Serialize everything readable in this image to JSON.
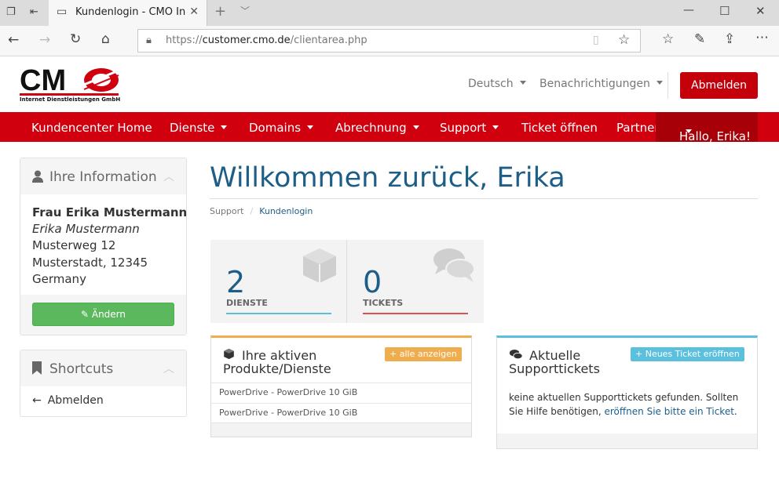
{
  "browser": {
    "tab_title": "Kundenlogin - CMO Internet Dienstleistungen GmbH",
    "url_prefix": "https://",
    "url_host": "customer.cmo.de",
    "url_path": "/clientarea.php"
  },
  "logo": {
    "brand": "CMO",
    "tagline": "Internet Dienstleistungen GmbH"
  },
  "header": {
    "language": "Deutsch",
    "notifications": "Benachrichtigungen",
    "logout": "Abmelden"
  },
  "nav": {
    "items": [
      "Kundencenter Home",
      "Dienste",
      "Domains",
      "Abrechnung",
      "Support",
      "Ticket öffnen",
      "Partner"
    ],
    "user": "Hallo, Erika!"
  },
  "sidebar": {
    "info_title": "Ihre Information",
    "name": "Frau Erika Mustermann",
    "company": "Erika Mustermann",
    "street": "Musterweg 12",
    "city": "Musterstadt, 12345",
    "country": "Germany",
    "edit_label": "Ändern",
    "shortcuts_title": "Shortcuts",
    "shortcut_logout": "Abmelden"
  },
  "main": {
    "welcome": "Willkommen zurück, Erika",
    "breadcrumb": [
      "Support",
      "Kundenlogin"
    ],
    "tiles": [
      {
        "count": "2",
        "label": "DIENSTE",
        "color": "#5bc0de"
      },
      {
        "count": "0",
        "label": "TICKETS",
        "color": "#d9534f"
      }
    ],
    "products": {
      "title_line1": "Ihre aktiven",
      "title_line2": "Produkte/Dienste",
      "button": "alle anzeigen",
      "rows": [
        "PowerDrive - PowerDrive 10 GiB",
        "PowerDrive - PowerDrive 10 GiB"
      ]
    },
    "tickets": {
      "title_line1": "Aktuelle",
      "title_line2": "Supporttickets",
      "button": "Neues Ticket eröffnen",
      "text_line1": "keine aktuellen Supporttickets gefunden. Sollten",
      "text_line2": "Sie Hilfe benötigen,",
      "link": "eröffnen Sie bitte ein Ticket",
      "text_end": "."
    }
  },
  "colors": {
    "brand_red": "#d1000f",
    "link_blue": "#1d5e88",
    "success": "#5cb85c",
    "warning": "#f0ad4e",
    "info": "#5bc0de"
  }
}
